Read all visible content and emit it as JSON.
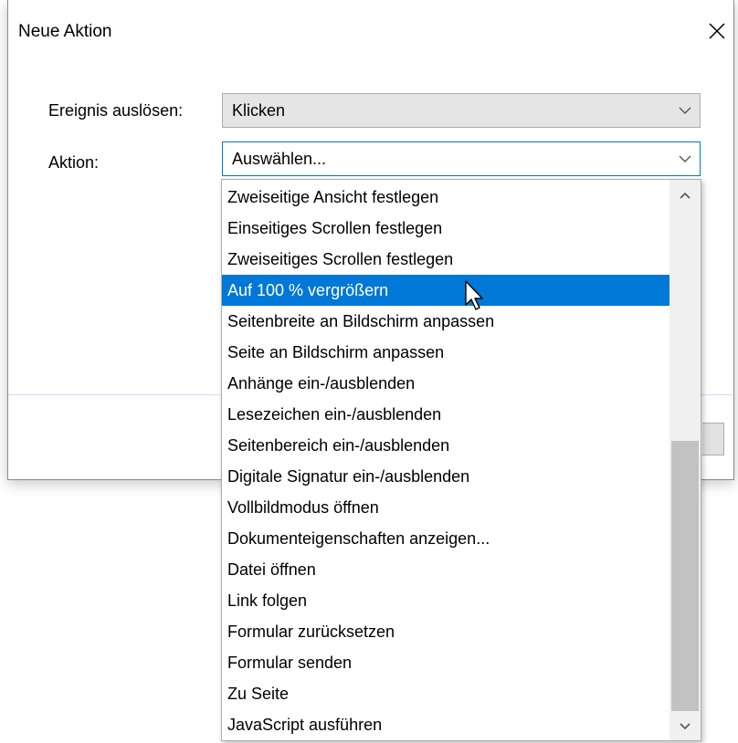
{
  "dialog": {
    "title": "Neue Aktion",
    "close_icon": "close-icon"
  },
  "form": {
    "trigger_label": "Ereignis auslösen:",
    "trigger_value": "Klicken",
    "action_label": "Aktion:",
    "action_value": "Auswählen..."
  },
  "dropdown": {
    "items": [
      "Zweiseitige Ansicht festlegen",
      "Einseitiges Scrollen festlegen",
      "Zweiseitiges Scrollen festlegen",
      "Auf 100 % vergrößern",
      "Seitenbreite an Bildschirm anpassen",
      "Seite an Bildschirm anpassen",
      "Anhänge ein-/ausblenden",
      "Lesezeichen ein-/ausblenden",
      "Seitenbereich ein-/ausblenden",
      "Digitale Signatur ein-/ausblenden",
      "Vollbildmodus öffnen",
      "Dokumenteigenschaften anzeigen...",
      "Datei öffnen",
      "Link folgen",
      "Formular zurücksetzen",
      "Formular senden",
      "Zu Seite",
      "JavaScript ausführen"
    ],
    "highlighted": "Auf 100 % vergrößern",
    "scroll_position": "bottom"
  },
  "colors": {
    "accent": "#0078d7",
    "scrollbar_thumb": "#c2c2c2",
    "scrollbar_track": "#f0f0f0"
  }
}
